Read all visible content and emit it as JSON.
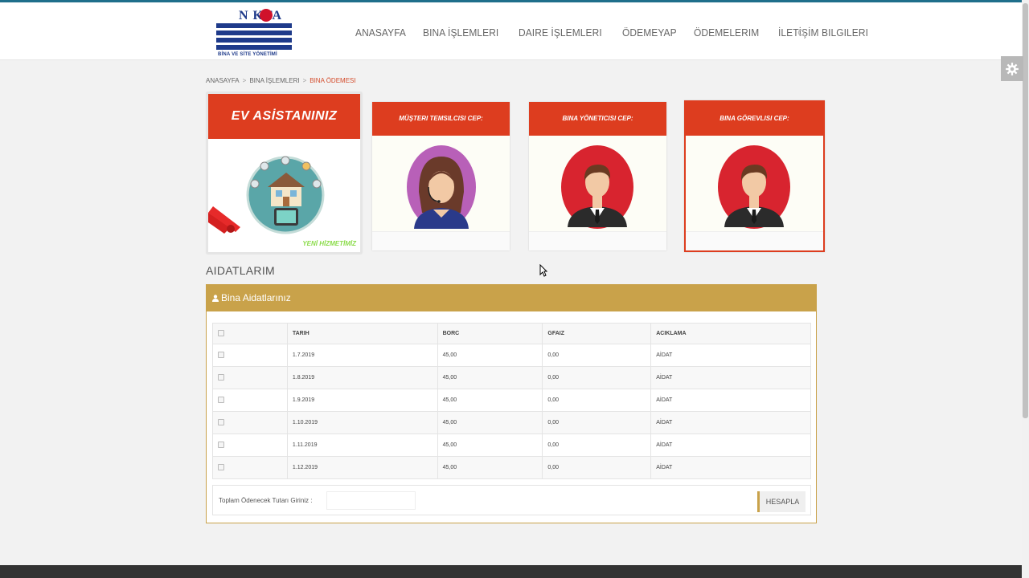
{
  "logo": {
    "brand": "N KTA",
    "subtitle": "BİNA VE SİTE YÖNETİMİ"
  },
  "nav": {
    "items": [
      "ANASAYFA",
      "BINA İŞLEMLERI",
      "DAIRE İŞLEMLERI",
      "ÖDEMEYAP",
      "ÖDEMELERIM",
      "İLETİŞİM BILGILERI"
    ]
  },
  "breadcrumb": [
    "ANASAYFA",
    "BINA İŞLEMLERI",
    "BINA ÖDEMESI"
  ],
  "cards": {
    "ev_asistan": {
      "title": "EV ASİSTANINIZ",
      "badge": "YENİ HİZMETİMİZ"
    },
    "musteri": {
      "title": "MÜŞTERI TEMSILCISI CEP:"
    },
    "yonetici": {
      "title": "BINA YÖNETICISI CEP:"
    },
    "gorevli": {
      "title": "BINA GÖREVLISI CEP:"
    }
  },
  "section_title": "AIDATLARIM",
  "panel": {
    "title": "Bina Aidatlarınız",
    "columns": [
      "TARIH",
      "BORC",
      "GFAIZ",
      "ACIKLAMA"
    ],
    "rows": [
      {
        "tarih": "1.7.2019",
        "borc": "45,00",
        "gfaiz": "0,00",
        "aciklama": "AİDAT"
      },
      {
        "tarih": "1.8.2019",
        "borc": "45,00",
        "gfaiz": "0,00",
        "aciklama": "AİDAT"
      },
      {
        "tarih": "1.9.2019",
        "borc": "45,00",
        "gfaiz": "0,00",
        "aciklama": "AİDAT"
      },
      {
        "tarih": "1.10.2019",
        "borc": "45,00",
        "gfaiz": "0,00",
        "aciklama": "AİDAT"
      },
      {
        "tarih": "1.11.2019",
        "borc": "45,00",
        "gfaiz": "0,00",
        "aciklama": "AİDAT"
      },
      {
        "tarih": "1.12.2019",
        "borc": "45,00",
        "gfaiz": "0,00",
        "aciklama": "AİDAT"
      }
    ],
    "total_label": "Toplam Ödenecek Tutarı Giriniz :",
    "total_value": "",
    "button_label": "HESAPLA"
  },
  "colors": {
    "accent": "#c9a24a",
    "card_red": "#dd3d1f",
    "top_line": "#1f6f8b"
  }
}
